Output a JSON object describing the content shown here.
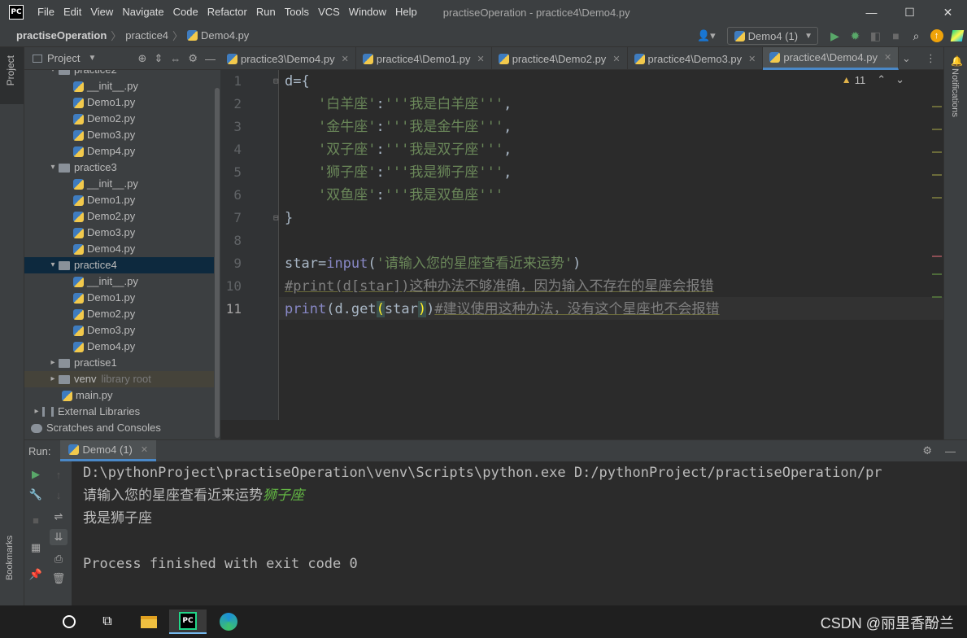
{
  "menu": {
    "logo": "PC",
    "items": [
      "File",
      "Edit",
      "View",
      "Navigate",
      "Code",
      "Refactor",
      "Run",
      "Tools",
      "VCS",
      "Window",
      "Help"
    ],
    "window_title": "practiseOperation - practice4\\Demo4.py"
  },
  "window_controls": {
    "minimize": "—",
    "maximize": "☐",
    "close": "✕"
  },
  "breadcrumb": {
    "project": "practiseOperation",
    "folder": "practice4",
    "file": "Demo4.py"
  },
  "run_config": {
    "label": "Demo4 (1)"
  },
  "project_panel": {
    "title": "Project",
    "tree": [
      {
        "label": "practice2",
        "type": "folder",
        "indent": 1,
        "arrow": "▾"
      },
      {
        "label": "__init__.py",
        "type": "py",
        "indent": 3
      },
      {
        "label": "Demo1.py",
        "type": "py",
        "indent": 3
      },
      {
        "label": "Demo2.py",
        "type": "py",
        "indent": 3
      },
      {
        "label": "Demo3.py",
        "type": "py",
        "indent": 3
      },
      {
        "label": "Demp4.py",
        "type": "py",
        "indent": 3
      },
      {
        "label": "practice3",
        "type": "folder",
        "indent": 1,
        "arrow": "▾"
      },
      {
        "label": "__init__.py",
        "type": "py",
        "indent": 3
      },
      {
        "label": "Demo1.py",
        "type": "py",
        "indent": 3
      },
      {
        "label": "Demo2.py",
        "type": "py",
        "indent": 3
      },
      {
        "label": "Demo3.py",
        "type": "py",
        "indent": 3
      },
      {
        "label": "Demo4.py",
        "type": "py",
        "indent": 3
      },
      {
        "label": "practice4",
        "type": "folder",
        "indent": 1,
        "arrow": "▾",
        "selected": true
      },
      {
        "label": "__init__.py",
        "type": "py",
        "indent": 3
      },
      {
        "label": "Demo1.py",
        "type": "py",
        "indent": 3
      },
      {
        "label": "Demo2.py",
        "type": "py",
        "indent": 3
      },
      {
        "label": "Demo3.py",
        "type": "py",
        "indent": 3
      },
      {
        "label": "Demo4.py",
        "type": "py",
        "indent": 3
      },
      {
        "label": "practise1",
        "type": "folder",
        "indent": 1,
        "arrow": "▸"
      },
      {
        "label": "venv",
        "type": "folder",
        "indent": 1,
        "arrow": "▸",
        "note": "library root",
        "venv": true
      },
      {
        "label": "main.py",
        "type": "py",
        "indent": 2
      },
      {
        "label": "External Libraries",
        "type": "lib",
        "indent": 0,
        "arrow": "▸"
      },
      {
        "label": "Scratches and Consoles",
        "type": "scratch",
        "indent": 0
      }
    ]
  },
  "tabs": [
    {
      "label": "practice3\\Demo4.py"
    },
    {
      "label": "practice4\\Demo1.py"
    },
    {
      "label": "practice4\\Demo2.py"
    },
    {
      "label": "practice4\\Demo3.py"
    },
    {
      "label": "practice4\\Demo4.py",
      "active": true
    }
  ],
  "editor": {
    "warnings": "11",
    "line_numbers": [
      "1",
      "2",
      "3",
      "4",
      "5",
      "6",
      "7",
      "8",
      "9",
      "10",
      "11"
    ],
    "current_line": "11",
    "code": {
      "l1": "d={",
      "l2_key": "'白羊座'",
      "l2_val": "'''我是白羊座'''",
      "l3_key": "'金牛座'",
      "l3_val": "'''我是金牛座'''",
      "l4_key": "'双子座'",
      "l4_val": "'''我是双子座'''",
      "l5_key": "'狮子座'",
      "l5_val": "'''我是狮子座'''",
      "l6_key": "'双鱼座'",
      "l6_val": "'''我是双鱼座'''",
      "l7": "}",
      "l9_var": "star",
      "l9_fn": "input",
      "l9_str": "'请输入您的星座查看近来运势'",
      "l10": "#print(d[star])这种办法不够准确，因为输入不存在的星座会报错",
      "l11_fn": "print",
      "l11_call": "d.get",
      "l11_arg": "star",
      "l11_cmt": "#建议使用这种办法，没有这个星座也不会报错"
    }
  },
  "notifications_label": "Notifications",
  "left_strip": {
    "project": "Project",
    "bookmarks": "Bookmarks"
  },
  "run_panel": {
    "label": "Run:",
    "tab": "Demo4 (1)",
    "console": {
      "cmd": "D:\\pythonProject\\practiseOperation\\venv\\Scripts\\python.exe D:/pythonProject/practiseOperation/pr",
      "prompt": "请输入您的星座查看近来运势",
      "input": "狮子座",
      "output": "我是狮子座",
      "exit": "Process finished with exit code 0"
    }
  },
  "watermark": "CSDN @丽里香酚兰"
}
